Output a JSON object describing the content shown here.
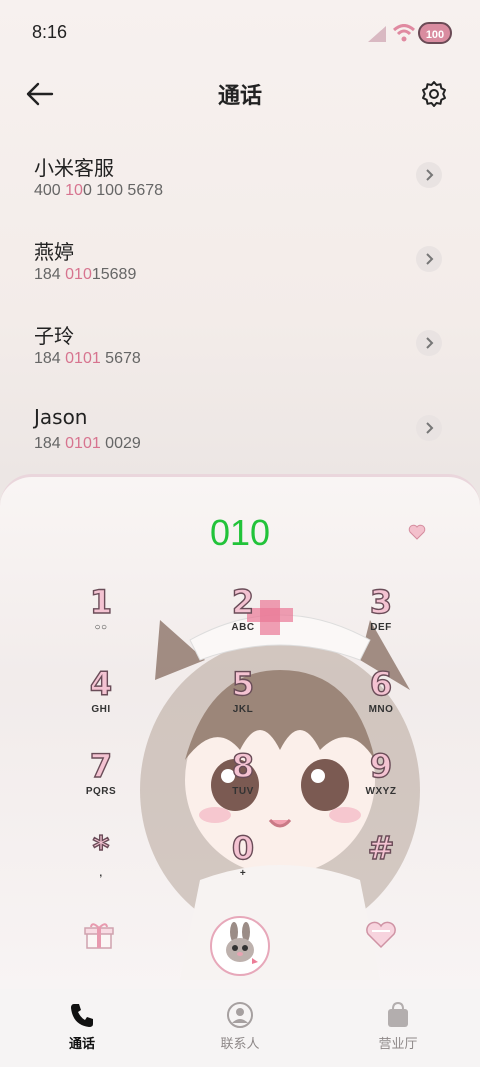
{
  "status": {
    "time": "8:16",
    "battery": "100"
  },
  "header": {
    "title": "通话"
  },
  "recents": [
    {
      "name": "小米客服",
      "num_pre": "400 ",
      "num_hl": "10",
      "num_post": "0 100 5678"
    },
    {
      "name": "燕婷",
      "num_pre": "184 ",
      "num_hl": "010",
      "num_post": "15689"
    },
    {
      "name": "子玲",
      "num_pre": "184 ",
      "num_hl": "0101",
      "num_post": " 5678"
    },
    {
      "name": "Jason",
      "num_pre": "184 ",
      "num_hl": "0101",
      "num_post": " 0029"
    }
  ],
  "dialer": {
    "input": "010",
    "keys": [
      {
        "digit": "1",
        "letters": ""
      },
      {
        "digit": "2",
        "letters": "ABC"
      },
      {
        "digit": "3",
        "letters": "DEF"
      },
      {
        "digit": "4",
        "letters": "GHI"
      },
      {
        "digit": "5",
        "letters": "JKL"
      },
      {
        "digit": "6",
        "letters": "MNO"
      },
      {
        "digit": "7",
        "letters": "PQRS"
      },
      {
        "digit": "8",
        "letters": "TUV"
      },
      {
        "digit": "9",
        "letters": "WXYZ"
      },
      {
        "digit": "*",
        "letters": ","
      },
      {
        "digit": "0",
        "letters": "+"
      },
      {
        "digit": "#",
        "letters": ""
      }
    ]
  },
  "nav": {
    "calls": "通话",
    "contacts": "联系人",
    "store": "营业厅"
  },
  "colors": {
    "accent_green": "#22c33a",
    "highlight_pink": "#d7748f"
  }
}
